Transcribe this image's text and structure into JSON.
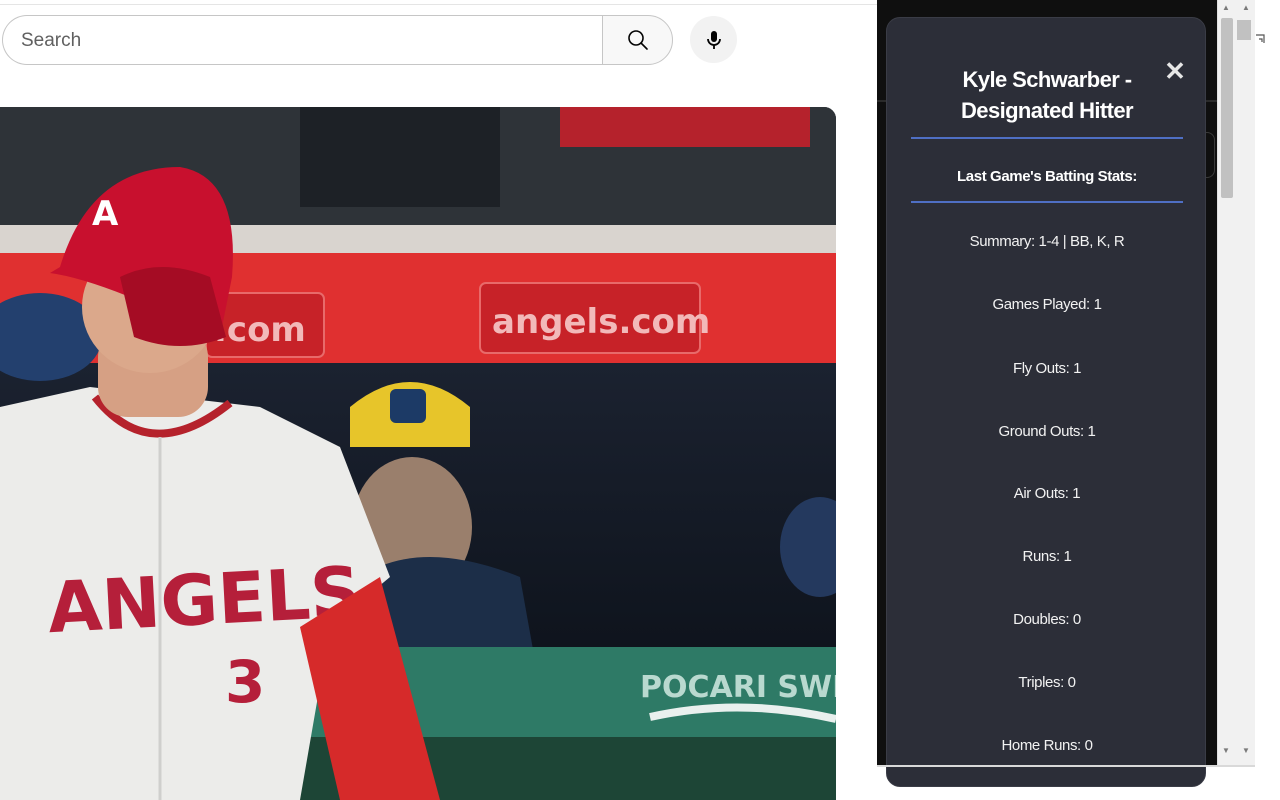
{
  "search": {
    "placeholder": "Search",
    "search_icon": "search-icon",
    "mic_icon": "microphone-icon"
  },
  "video": {
    "description_icon": "video-frame",
    "banner_left": ".com",
    "banner_right": "angels.com",
    "jersey_text": "ANGELS",
    "jersey_number": "3",
    "ad_text": "POCARI SWEA"
  },
  "popup": {
    "title": "Kyle Schwarber - Designated Hitter",
    "close_label": "✕",
    "section_heading": "Last Game's Batting Stats:",
    "stats": [
      "Summary: 1-4 | BB, K, R",
      "Games Played: 1",
      "Fly Outs: 1",
      "Ground Outs: 1",
      "Air Outs: 1",
      "Runs: 1",
      "Doubles: 0",
      "Triples: 0",
      "Home Runs: 0"
    ],
    "colors": {
      "background": "#2c2e38",
      "rule": "#4f6fc4"
    }
  },
  "scrollbar": {
    "up_label": "▲",
    "down_label": "▼"
  }
}
